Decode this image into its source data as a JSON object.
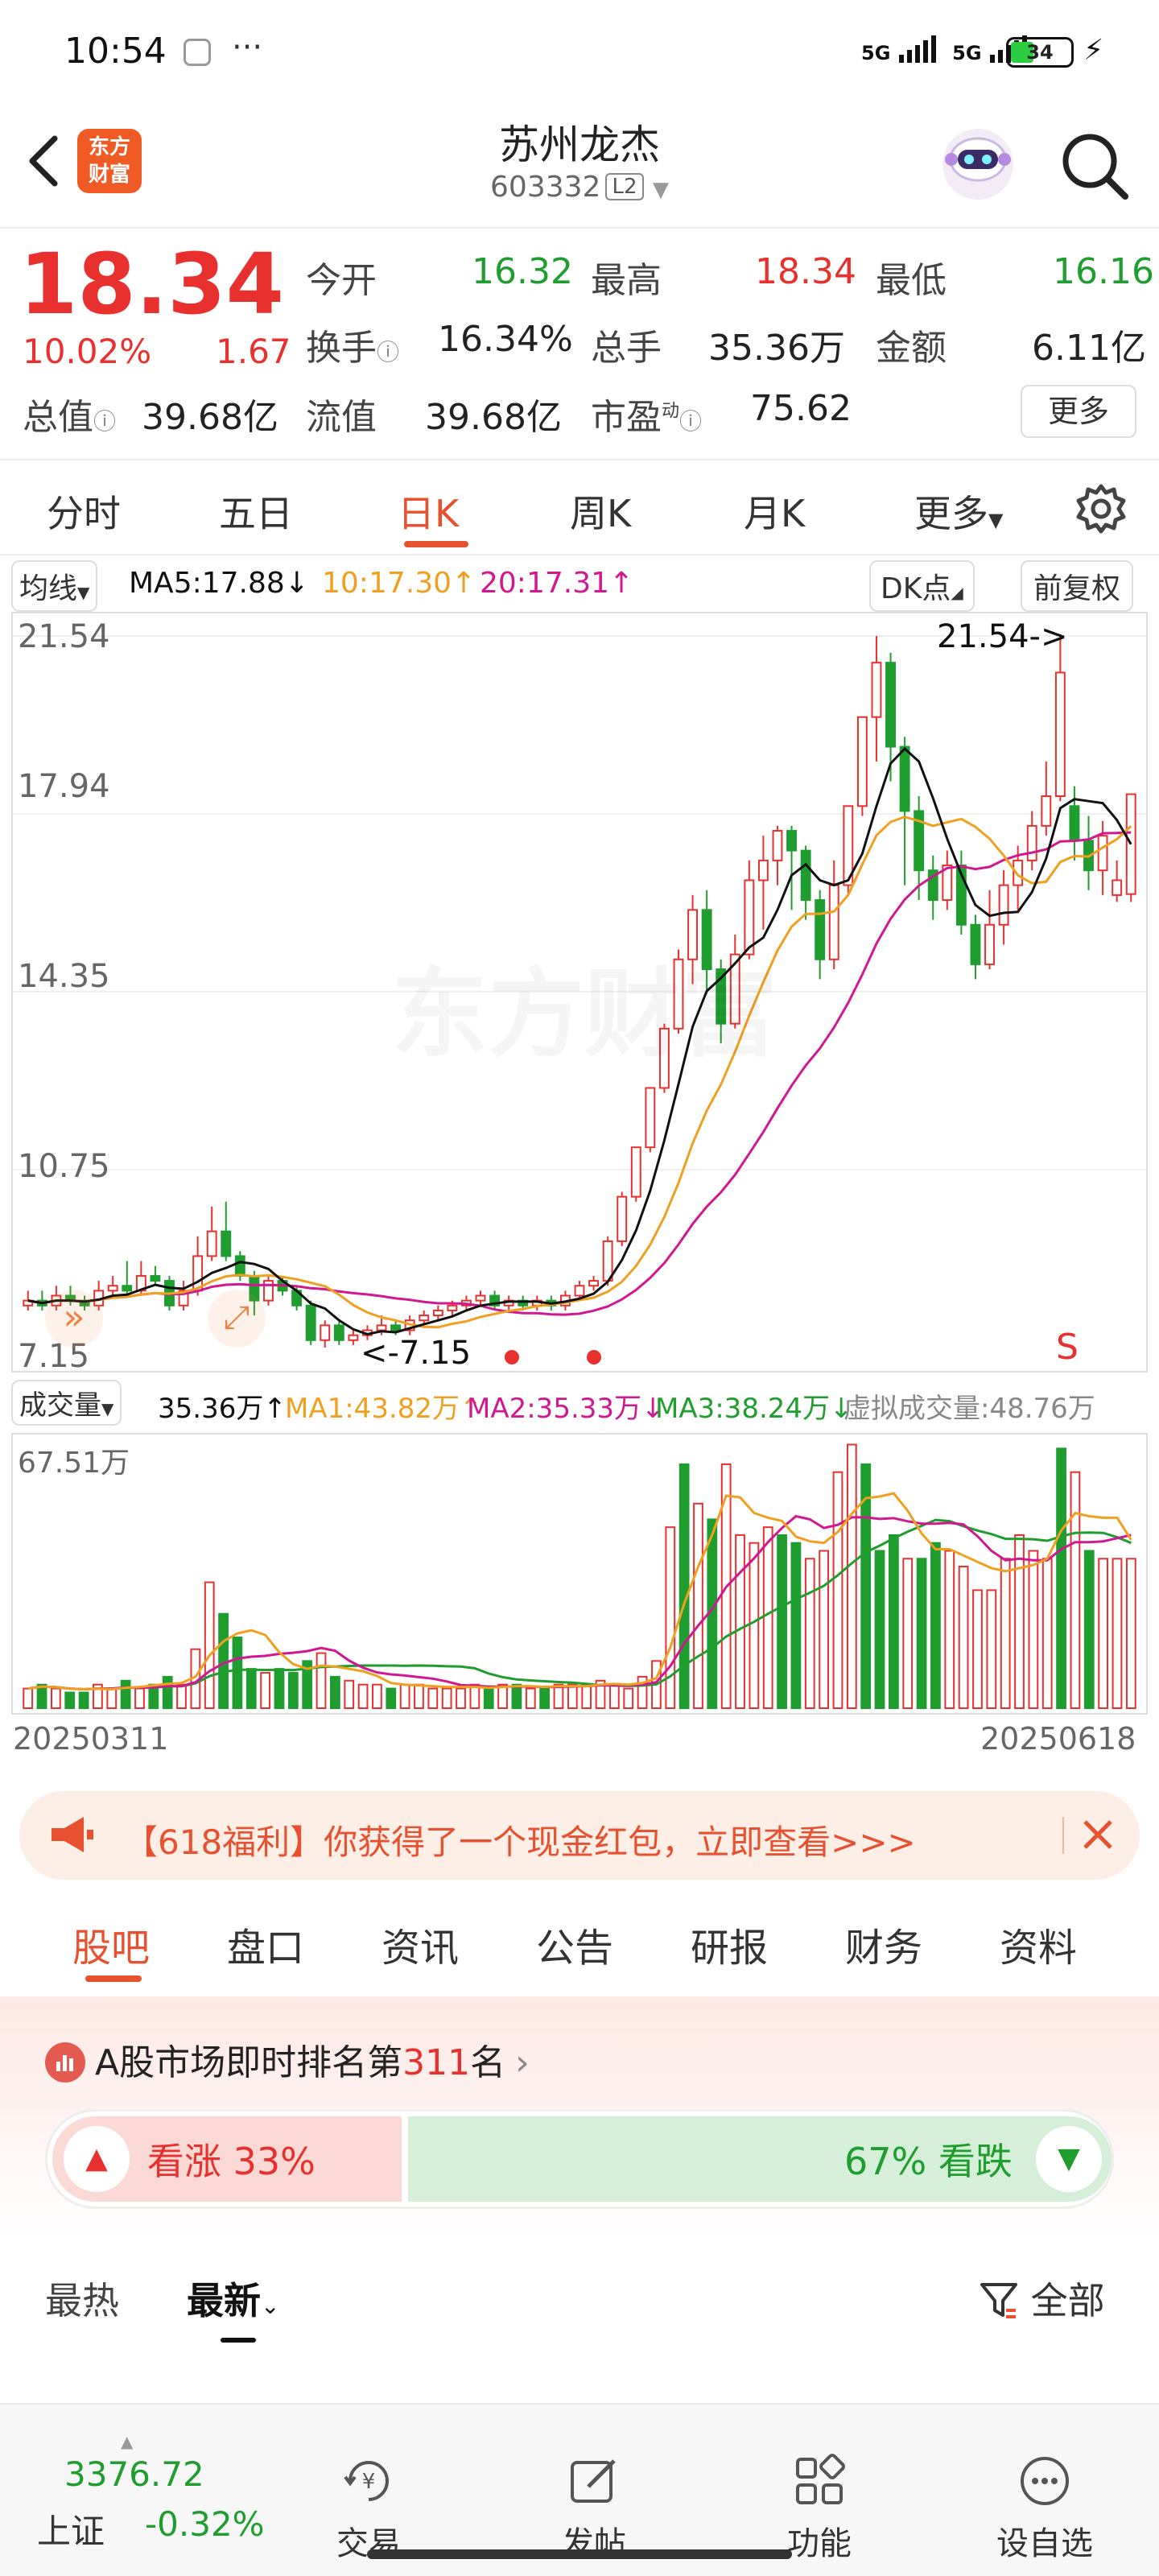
{
  "status_bar": {
    "time": "10:54",
    "dots": "···",
    "net1": "5G",
    "net2": "5G",
    "battery": "34"
  },
  "header": {
    "back_icon": "chevron-left-icon",
    "logo_text_1": "东方",
    "logo_text_2": "财富",
    "title": "苏州龙杰",
    "code": "603332",
    "level": "L2",
    "search_icon": "search-icon"
  },
  "quote": {
    "price": "18.34",
    "change_pct": "10.02%",
    "change": "1.67",
    "open_label": "今开",
    "open": "16.32",
    "high_label": "最高",
    "high": "18.34",
    "low_label": "最低",
    "low": "16.16",
    "turnover_label": "换手",
    "turnover": "16.34%",
    "volume_label": "总手",
    "volume": "35.36万",
    "amount_label": "金额",
    "amount": "6.11亿",
    "mktcap_label": "总值",
    "mktcap": "39.68亿",
    "float_label": "流值",
    "float": "39.68亿",
    "pe_label": "市盈",
    "pe_sup": "动",
    "pe": "75.62",
    "more_button": "更多"
  },
  "period_tabs": [
    "分时",
    "五日",
    "日K",
    "周K",
    "月K",
    "更多"
  ],
  "active_period": "日K",
  "ma_bar": {
    "selector": "均线",
    "ma5": "MA5:17.88↓",
    "ma10": "10:17.30↑",
    "ma20": "20:17.31↑",
    "dk_button": "DK点",
    "adjust_button": "前复权"
  },
  "colors": {
    "up": "#e8312f",
    "down": "#1f9d2e",
    "ma5": "#111111",
    "ma10": "#f0a020",
    "ma20": "#d01890",
    "accent": "#e8512f"
  },
  "chart_data": [
    {
      "type": "candlestick",
      "ylim": [
        7.15,
        21.54
      ],
      "y_ticks": [
        "21.54",
        "17.94",
        "14.35",
        "10.75",
        "7.15"
      ],
      "high_annotation": "21.54->",
      "low_annotation": "<-7.15",
      "sell_marker": "S",
      "watermark": "东方财富",
      "candles": [
        {
          "o": 8.0,
          "c": 8.1,
          "h": 8.3,
          "l": 7.9
        },
        {
          "o": 8.1,
          "c": 8.0,
          "h": 8.3,
          "l": 7.9
        },
        {
          "o": 8.0,
          "c": 8.2,
          "h": 8.4,
          "l": 7.9
        },
        {
          "o": 8.2,
          "c": 8.1,
          "h": 8.4,
          "l": 8.0
        },
        {
          "o": 8.1,
          "c": 8.0,
          "h": 8.2,
          "l": 7.9
        },
        {
          "o": 8.0,
          "c": 8.3,
          "h": 8.5,
          "l": 7.9
        },
        {
          "o": 8.3,
          "c": 8.4,
          "h": 8.6,
          "l": 8.2
        },
        {
          "o": 8.4,
          "c": 8.3,
          "h": 8.9,
          "l": 8.2
        },
        {
          "o": 8.3,
          "c": 8.6,
          "h": 8.9,
          "l": 8.2
        },
        {
          "o": 8.6,
          "c": 8.5,
          "h": 8.8,
          "l": 8.4
        },
        {
          "o": 8.5,
          "c": 8.0,
          "h": 8.6,
          "l": 7.9
        },
        {
          "o": 8.0,
          "c": 8.3,
          "h": 8.5,
          "l": 7.9
        },
        {
          "o": 8.3,
          "c": 9.0,
          "h": 9.4,
          "l": 8.2
        },
        {
          "o": 9.0,
          "c": 9.5,
          "h": 10.0,
          "l": 8.9
        },
        {
          "o": 9.5,
          "c": 9.0,
          "h": 10.1,
          "l": 8.9
        },
        {
          "o": 9.0,
          "c": 8.6,
          "h": 9.1,
          "l": 8.5
        },
        {
          "o": 8.6,
          "c": 8.1,
          "h": 8.7,
          "l": 7.8
        },
        {
          "o": 8.1,
          "c": 8.5,
          "h": 8.6,
          "l": 8.0
        },
        {
          "o": 8.5,
          "c": 8.3,
          "h": 8.6,
          "l": 8.2
        },
        {
          "o": 8.3,
          "c": 8.0,
          "h": 8.4,
          "l": 7.9
        },
        {
          "o": 8.0,
          "c": 7.3,
          "h": 8.1,
          "l": 7.2
        },
        {
          "o": 7.3,
          "c": 7.6,
          "h": 7.7,
          "l": 7.15
        },
        {
          "o": 7.6,
          "c": 7.3,
          "h": 7.7,
          "l": 7.2
        },
        {
          "o": 7.3,
          "c": 7.4,
          "h": 7.5,
          "l": 7.2
        },
        {
          "o": 7.4,
          "c": 7.5,
          "h": 7.6,
          "l": 7.3
        },
        {
          "o": 7.5,
          "c": 7.6,
          "h": 7.8,
          "l": 7.4
        },
        {
          "o": 7.6,
          "c": 7.5,
          "h": 7.7,
          "l": 7.4
        },
        {
          "o": 7.5,
          "c": 7.7,
          "h": 7.8,
          "l": 7.4
        },
        {
          "o": 7.7,
          "c": 7.8,
          "h": 7.9,
          "l": 7.6
        },
        {
          "o": 7.8,
          "c": 7.9,
          "h": 8.0,
          "l": 7.7
        },
        {
          "o": 7.9,
          "c": 8.0,
          "h": 8.1,
          "l": 7.8
        },
        {
          "o": 8.0,
          "c": 8.1,
          "h": 8.2,
          "l": 7.9
        },
        {
          "o": 8.1,
          "c": 8.2,
          "h": 8.3,
          "l": 8.0
        },
        {
          "o": 8.2,
          "c": 8.0,
          "h": 8.3,
          "l": 7.9
        },
        {
          "o": 8.0,
          "c": 8.1,
          "h": 8.2,
          "l": 7.9
        },
        {
          "o": 8.1,
          "c": 8.0,
          "h": 8.2,
          "l": 7.9
        },
        {
          "o": 8.0,
          "c": 8.1,
          "h": 8.2,
          "l": 7.9
        },
        {
          "o": 8.1,
          "c": 8.0,
          "h": 8.2,
          "l": 7.9
        },
        {
          "o": 8.0,
          "c": 8.2,
          "h": 8.3,
          "l": 7.9
        },
        {
          "o": 8.2,
          "c": 8.4,
          "h": 8.5,
          "l": 8.1
        },
        {
          "o": 8.4,
          "c": 8.5,
          "h": 8.6,
          "l": 8.3
        },
        {
          "o": 8.5,
          "c": 9.3,
          "h": 9.4,
          "l": 8.4
        },
        {
          "o": 9.3,
          "c": 10.2,
          "h": 10.3,
          "l": 9.2
        },
        {
          "o": 10.2,
          "c": 11.2,
          "h": 11.2,
          "l": 10.1
        },
        {
          "o": 11.2,
          "c": 12.4,
          "h": 12.4,
          "l": 11.1
        },
        {
          "o": 12.4,
          "c": 13.6,
          "h": 13.7,
          "l": 12.3
        },
        {
          "o": 13.6,
          "c": 15.0,
          "h": 15.2,
          "l": 13.5
        },
        {
          "o": 15.0,
          "c": 16.0,
          "h": 16.3,
          "l": 14.5
        },
        {
          "o": 16.0,
          "c": 14.8,
          "h": 16.4,
          "l": 14.3
        },
        {
          "o": 14.8,
          "c": 13.7,
          "h": 15.0,
          "l": 13.3
        },
        {
          "o": 13.7,
          "c": 15.1,
          "h": 15.5,
          "l": 13.6
        },
        {
          "o": 15.1,
          "c": 16.6,
          "h": 17.0,
          "l": 15.0
        },
        {
          "o": 16.6,
          "c": 17.0,
          "h": 17.5,
          "l": 15.6
        },
        {
          "o": 17.0,
          "c": 17.6,
          "h": 17.7,
          "l": 16.5
        },
        {
          "o": 17.6,
          "c": 17.2,
          "h": 17.7,
          "l": 16.0
        },
        {
          "o": 17.2,
          "c": 16.2,
          "h": 17.3,
          "l": 15.8
        },
        {
          "o": 16.2,
          "c": 15.0,
          "h": 16.4,
          "l": 14.6
        },
        {
          "o": 15.0,
          "c": 16.5,
          "h": 17.0,
          "l": 14.8
        },
        {
          "o": 16.5,
          "c": 18.1,
          "h": 18.1,
          "l": 16.3
        },
        {
          "o": 18.1,
          "c": 19.9,
          "h": 19.9,
          "l": 17.9
        },
        {
          "o": 19.9,
          "c": 21.0,
          "h": 21.54,
          "l": 19.0
        },
        {
          "o": 21.0,
          "c": 19.3,
          "h": 21.2,
          "l": 18.6
        },
        {
          "o": 19.3,
          "c": 18.0,
          "h": 19.5,
          "l": 16.5
        },
        {
          "o": 18.0,
          "c": 16.8,
          "h": 18.3,
          "l": 16.2
        },
        {
          "o": 16.8,
          "c": 16.2,
          "h": 17.1,
          "l": 15.8
        },
        {
          "o": 16.2,
          "c": 16.9,
          "h": 17.2,
          "l": 16.0
        },
        {
          "o": 16.9,
          "c": 15.7,
          "h": 17.2,
          "l": 15.5
        },
        {
          "o": 15.7,
          "c": 14.9,
          "h": 15.9,
          "l": 14.6
        },
        {
          "o": 14.9,
          "c": 15.7,
          "h": 16.4,
          "l": 14.8
        },
        {
          "o": 15.7,
          "c": 16.5,
          "h": 16.8,
          "l": 15.3
        },
        {
          "o": 16.5,
          "c": 17.0,
          "h": 17.3,
          "l": 16.0
        },
        {
          "o": 17.0,
          "c": 17.7,
          "h": 18.0,
          "l": 16.8
        },
        {
          "o": 17.7,
          "c": 18.3,
          "h": 19.0,
          "l": 17.5
        },
        {
          "o": 18.3,
          "c": 20.8,
          "h": 21.54,
          "l": 18.2
        },
        {
          "o": 18.1,
          "c": 17.4,
          "h": 18.5,
          "l": 17.0
        },
        {
          "o": 17.4,
          "c": 16.8,
          "h": 17.9,
          "l": 16.4
        },
        {
          "o": 16.8,
          "c": 17.5,
          "h": 17.8,
          "l": 16.3
        },
        {
          "o": 16.3,
          "c": 16.6,
          "h": 17.0,
          "l": 16.16
        },
        {
          "o": 16.32,
          "c": 18.34,
          "h": 18.34,
          "l": 16.16
        }
      ]
    },
    {
      "type": "bar",
      "ylim": [
        0,
        67.51
      ],
      "y_tick": "67.51万",
      "x_start": "20250311",
      "x_end": "20250618",
      "values": [
        5,
        6,
        5,
        4,
        4,
        6,
        5,
        7,
        5,
        6,
        8,
        6,
        15,
        32,
        24,
        18,
        10,
        9,
        10,
        9,
        12,
        14,
        8,
        7,
        6,
        6,
        5,
        6,
        6,
        5,
        5,
        5,
        6,
        5,
        6,
        6,
        5,
        5,
        6,
        6,
        6,
        7,
        6,
        5,
        8,
        12,
        46,
        62,
        52,
        48,
        62,
        44,
        42,
        46,
        44,
        42,
        38,
        40,
        60,
        67,
        62,
        40,
        44,
        38,
        38,
        42,
        40,
        36,
        30,
        30,
        38,
        44,
        40,
        38,
        66,
        60,
        40,
        38,
        38,
        38
      ],
      "up": [
        1,
        0,
        1,
        0,
        0,
        1,
        1,
        0,
        1,
        0,
        0,
        1,
        1,
        1,
        0,
        0,
        0,
        1,
        0,
        0,
        0,
        1,
        0,
        1,
        1,
        1,
        0,
        1,
        1,
        1,
        1,
        1,
        1,
        0,
        1,
        0,
        1,
        0,
        1,
        1,
        1,
        1,
        1,
        1,
        1,
        1,
        1,
        0,
        1,
        0,
        1,
        1,
        1,
        1,
        0,
        0,
        1,
        1,
        1,
        1,
        0,
        0,
        0,
        1,
        0,
        0,
        1,
        1,
        1,
        1,
        1,
        1,
        1,
        1,
        0,
        1,
        0,
        1,
        1,
        1
      ]
    }
  ],
  "volume_bar": {
    "selector": "成交量",
    "vol": "35.36万↑",
    "ma1": "MA1:43.82万↑",
    "ma2": "MA2:35.33万↓",
    "ma3": "MA3:38.24万↓",
    "virtual": "虚拟成交量:48.76万"
  },
  "banner": {
    "text": "【618福利】你获得了一个现金红包，立即查看>>>"
  },
  "info_tabs": [
    "股吧",
    "盘口",
    "资讯",
    "公告",
    "研报",
    "财务",
    "资料"
  ],
  "active_info_tab": "股吧",
  "ranking": {
    "prefix": "A股市场即时排名第",
    "rank": "311",
    "suffix": "名"
  },
  "sentiment": {
    "up_label": "看涨",
    "up_pct": "33%",
    "down_pct": "67%",
    "down_label": "看跌",
    "up_fraction": 0.33
  },
  "sort_tabs": {
    "hot": "最热",
    "latest": "最新",
    "filter": "全部"
  },
  "bottom_nav": {
    "index_value": "3376.72",
    "index_name": "上证",
    "index_change": "-0.32%",
    "items": [
      "交易",
      "发帖",
      "功能",
      "设自选"
    ]
  }
}
